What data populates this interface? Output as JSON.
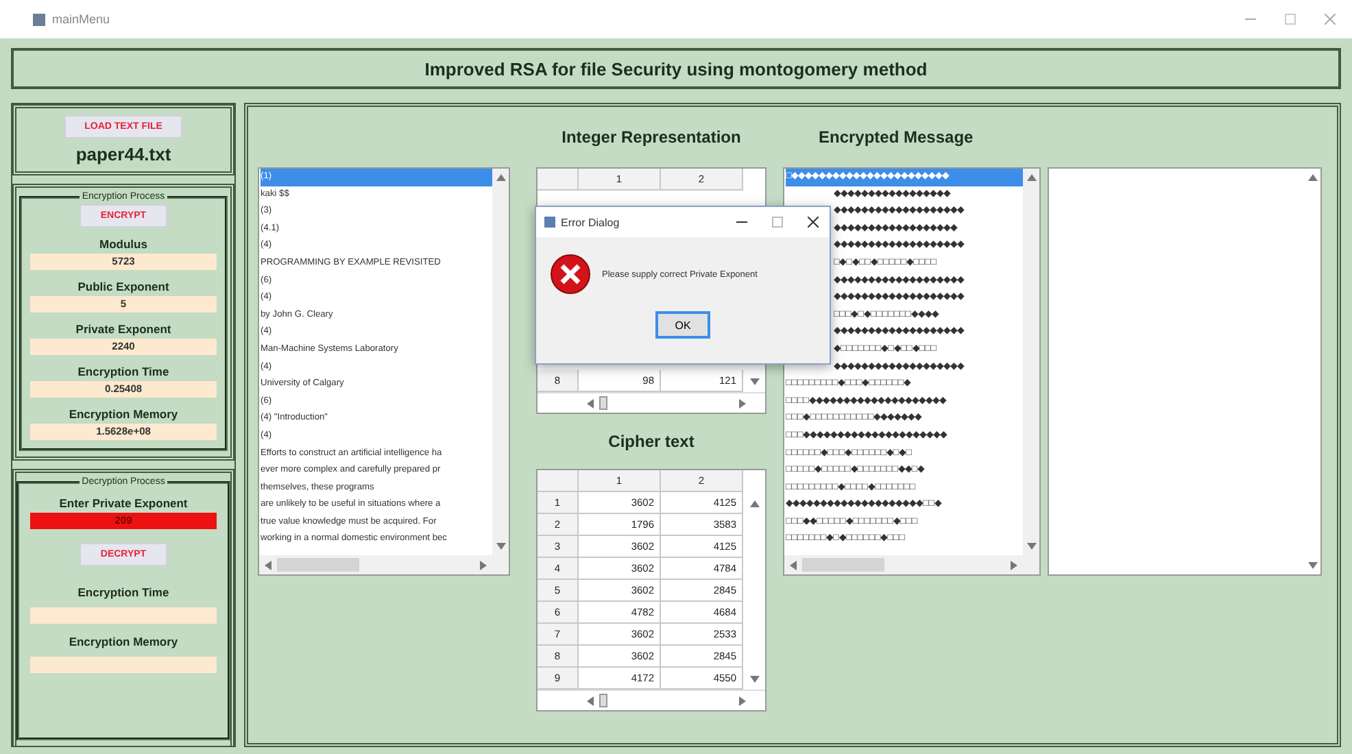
{
  "window": {
    "title": "mainMenu"
  },
  "header": {
    "title": "Improved RSA for file Security using montogomery method"
  },
  "load_panel": {
    "button": "LOAD TEXT FILE",
    "file_name": "paper44.txt"
  },
  "encryption": {
    "legend": "Encryption Process",
    "button": "ENCRYPT",
    "fields": [
      {
        "label": "Modulus",
        "value": "5723",
        "error": false
      },
      {
        "label": "Public Exponent",
        "value": "5",
        "error": false
      },
      {
        "label": "Private Exponent",
        "value": "2240",
        "error": false
      },
      {
        "label": "Encryption Time",
        "value": "0.25408",
        "error": false
      },
      {
        "label": "Encryption Memory",
        "value": "1.5628e+08",
        "error": false
      }
    ]
  },
  "decryption": {
    "legend": "Decryption Process",
    "input": {
      "label": "Enter Private Exponent",
      "value": "209",
      "error": true
    },
    "button": "DECRYPT",
    "fields": [
      {
        "label": "Encryption Time",
        "error": false
      },
      {
        "label": "Encryption Memory",
        "error": false
      }
    ]
  },
  "text_list": {
    "items": [
      {
        "text": "(1)",
        "selected": true
      },
      {
        "text": "kaki $$",
        "selected": false
      },
      {
        "text": "(3)",
        "selected": false
      },
      {
        "text": "(4.1)",
        "selected": false
      },
      {
        "text": "(4)",
        "selected": false
      },
      {
        "text": "PROGRAMMING BY EXAMPLE REVISITED",
        "selected": false
      },
      {
        "text": "(6)",
        "selected": false
      },
      {
        "text": "(4)",
        "selected": false
      },
      {
        "text": "by John G. Cleary",
        "selected": false
      },
      {
        "text": "(4)",
        "selected": false
      },
      {
        "text": "Man-Machine Systems Laboratory",
        "selected": false
      },
      {
        "text": "(4)",
        "selected": false
      },
      {
        "text": "University of Calgary",
        "selected": false
      },
      {
        "text": "(6)",
        "selected": false
      },
      {
        "text": "(4) \"Introduction\"",
        "selected": false
      },
      {
        "text": "(4)",
        "selected": false
      },
      {
        "text": "Efforts to construct an artificial intelligence ha",
        "selected": false
      },
      {
        "text": "ever more complex and carefully prepared pr",
        "selected": false
      },
      {
        "text": "themselves, these programs",
        "selected": false
      },
      {
        "text": "are unlikely to be useful in situations where a",
        "selected": false
      },
      {
        "text": "true value knowledge must be acquired. For",
        "selected": false
      },
      {
        "text": "working in a normal domestic environment bec",
        "selected": false
      }
    ]
  },
  "integer_table": {
    "title": "Integer Representation",
    "columns": [
      "1",
      "2"
    ],
    "rows": [
      {
        "index": "8",
        "cells": [
          "98",
          "121"
        ]
      }
    ]
  },
  "cipher_table": {
    "title": "Cipher text",
    "columns": [
      "1",
      "2"
    ],
    "rows": [
      {
        "index": "1",
        "cells": [
          "3602",
          "4125"
        ]
      },
      {
        "index": "2",
        "cells": [
          "1796",
          "3583"
        ]
      },
      {
        "index": "3",
        "cells": [
          "3602",
          "4125"
        ]
      },
      {
        "index": "4",
        "cells": [
          "3602",
          "4784"
        ]
      },
      {
        "index": "5",
        "cells": [
          "3602",
          "2845"
        ]
      },
      {
        "index": "6",
        "cells": [
          "4782",
          "4684"
        ]
      },
      {
        "index": "7",
        "cells": [
          "3602",
          "2533"
        ]
      },
      {
        "index": "8",
        "cells": [
          "3602",
          "2845"
        ]
      },
      {
        "index": "9",
        "cells": [
          "4172",
          "4550"
        ]
      }
    ]
  },
  "encrypted_message": {
    "title": "Encrypted Message",
    "items": [
      {
        "kind": "full",
        "text": "□◆◆◆◆◆◆◆◆◆◆◆◆◆◆◆◆◆◆◆◆◆◆◆",
        "selected": true
      },
      {
        "kind": "partial",
        "text": "◆◆◆◆◆◆◆◆◆◆◆◆◆◆◆◆◆",
        "selected": false
      },
      {
        "kind": "partial",
        "text": "◆◆◆◆◆◆◆◆◆◆◆◆◆◆◆◆◆◆◆",
        "selected": false
      },
      {
        "kind": "partial",
        "text": "◆◆◆◆◆◆◆◆◆◆◆◆◆◆◆◆◆◆",
        "selected": false
      },
      {
        "kind": "partial",
        "text": "◆◆◆◆◆◆◆◆◆◆◆◆◆◆◆◆◆◆◆",
        "selected": false
      },
      {
        "kind": "partial",
        "text": "□◆□◆□□◆□□□□□◆□□□□",
        "selected": false
      },
      {
        "kind": "partial",
        "text": "◆◆◆◆◆◆◆◆◆◆◆◆◆◆◆◆◆◆◆",
        "selected": false
      },
      {
        "kind": "partial",
        "text": "◆◆◆◆◆◆◆◆◆◆◆◆◆◆◆◆◆◆◆",
        "selected": false
      },
      {
        "kind": "partial",
        "text": "□□□◆□◆□□□□□□□◆◆◆◆",
        "selected": false
      },
      {
        "kind": "partial",
        "text": "◆◆◆◆◆◆◆◆◆◆◆◆◆◆◆◆◆◆◆",
        "selected": false
      },
      {
        "kind": "partial",
        "text": "◆□□□□□□□◆□◆□□◆□□□",
        "selected": false
      },
      {
        "kind": "partial",
        "text": "◆◆◆◆◆◆◆◆◆◆◆◆◆◆◆◆◆◆◆",
        "selected": false
      },
      {
        "kind": "full",
        "text": "□□□□□□□□□◆□□□◆□□□□□□◆",
        "selected": false
      },
      {
        "kind": "full",
        "text": "□□□□◆◆◆◆◆◆◆◆◆◆◆◆◆◆◆◆◆◆◆◆",
        "selected": false
      },
      {
        "kind": "full",
        "text": "□□□◆□□□□□□□□□□□◆◆◆◆◆◆◆",
        "selected": false
      },
      {
        "kind": "full",
        "text": "□□□◆◆◆◆◆◆◆◆◆◆◆◆◆◆◆◆◆◆◆◆◆",
        "selected": false
      },
      {
        "kind": "full",
        "text": "□□□□□□◆□□□◆□□□□□□◆□◆□",
        "selected": false
      },
      {
        "kind": "full",
        "text": "□□□□□◆□□□□□◆□□□□□□□◆◆□◆",
        "selected": false
      },
      {
        "kind": "full",
        "text": "□□□□□□□□□◆□□□□◆□□□□□□□",
        "selected": false
      },
      {
        "kind": "full",
        "text": "◆◆◆◆◆◆◆◆◆◆◆◆◆◆◆◆◆◆◆◆□□◆",
        "selected": false
      },
      {
        "kind": "full",
        "text": "□□□◆◆□□□□□◆□□□□□□□◆□□□",
        "selected": false
      },
      {
        "kind": "full",
        "text": "□□□□□□□◆□◆□□□□□□◆□□□",
        "selected": false
      }
    ]
  },
  "dialog": {
    "title": "Error Dialog",
    "message": "Please supply correct Private Exponent",
    "button": "OK"
  }
}
